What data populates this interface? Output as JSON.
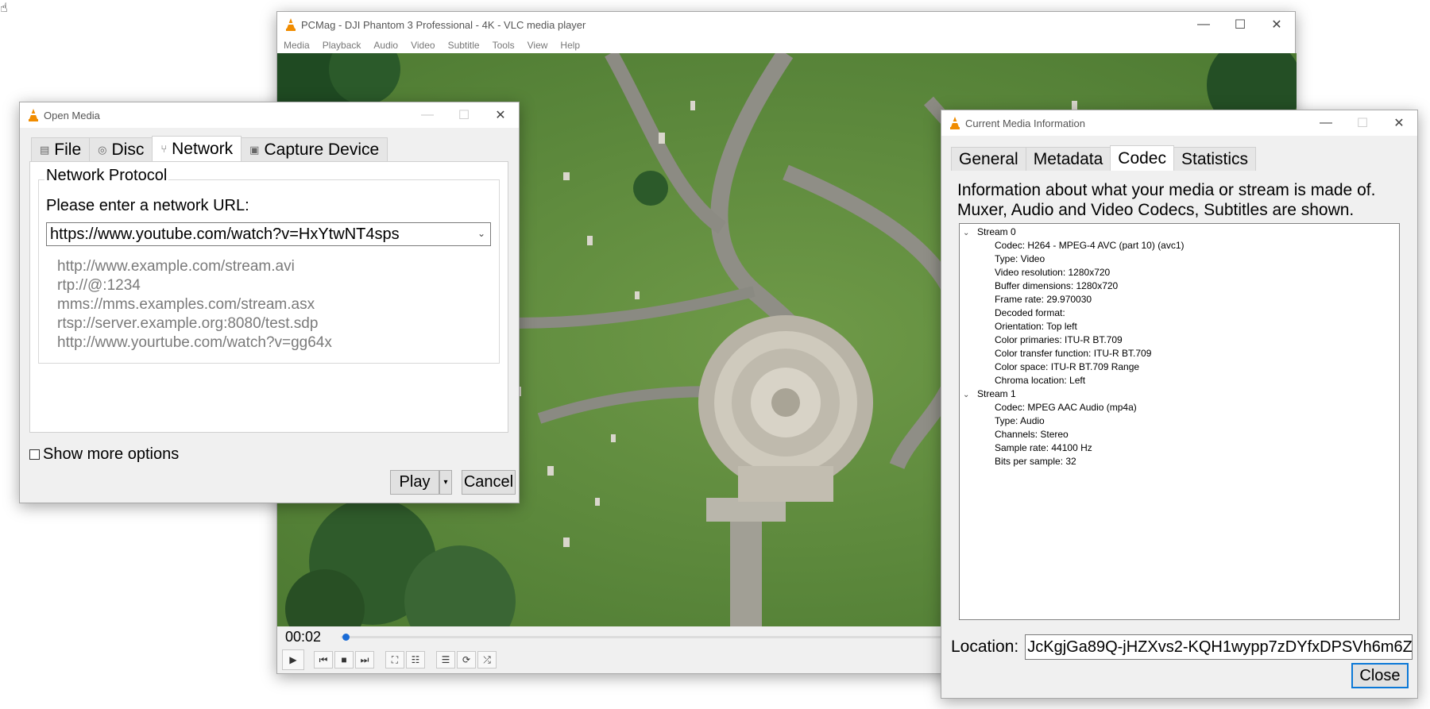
{
  "vlc": {
    "title": "PCMag - DJI Phantom 3 Professional - 4K - VLC media player",
    "menu": [
      "Media",
      "Playback",
      "Audio",
      "Video",
      "Subtitle",
      "Tools",
      "View",
      "Help"
    ],
    "time": "00:02",
    "progress": 0.004
  },
  "open_media": {
    "title": "Open Media",
    "tabs": [
      {
        "label": "File",
        "active": false
      },
      {
        "label": "Disc",
        "active": false
      },
      {
        "label": "Network",
        "active": true
      },
      {
        "label": "Capture Device",
        "active": false
      }
    ],
    "group_label": "Network Protocol",
    "url_label": "Please enter a network URL:",
    "url_value": "https://www.youtube.com/watch?v=HxYtwNT4sps",
    "examples": [
      "http://www.example.com/stream.avi",
      "rtp://@:1234",
      "mms://mms.examples.com/stream.asx",
      "rtsp://server.example.org:8080/test.sdp",
      "http://www.yourtube.com/watch?v=gg64x"
    ],
    "show_more_options": "Show more options",
    "play": "Play",
    "cancel": "Cancel"
  },
  "media_info": {
    "title": "Current Media Information",
    "tabs": [
      {
        "label": "General",
        "active": false
      },
      {
        "label": "Metadata",
        "active": false
      },
      {
        "label": "Codec",
        "active": true
      },
      {
        "label": "Statistics",
        "active": false
      }
    ],
    "description_line1": "Information about what your media or stream is made of.",
    "description_line2": "Muxer, Audio and Video Codecs, Subtitles are shown.",
    "streams": [
      {
        "label": "Stream 0",
        "items": [
          "Codec: H264 - MPEG-4 AVC (part 10) (avc1)",
          "Type: Video",
          "Video resolution: 1280x720",
          "Buffer dimensions: 1280x720",
          "Frame rate: 29.970030",
          "Decoded format:",
          "Orientation: Top left",
          "Color primaries: ITU-R BT.709",
          "Color transfer function: ITU-R BT.709",
          "Color space: ITU-R BT.709 Range",
          "Chroma location: Left"
        ]
      },
      {
        "label": "Stream 1",
        "items": [
          "Codec: MPEG AAC Audio (mp4a)",
          "Type: Audio",
          "Channels: Stereo",
          "Sample rate: 44100 Hz",
          "Bits per sample: 32"
        ]
      }
    ],
    "location_label": "Location:",
    "location_value": "JcKgjGa89Q-jHZXvs2-KQH1wypp7zDYfxDPSVh6m6Z",
    "close": "Close"
  }
}
